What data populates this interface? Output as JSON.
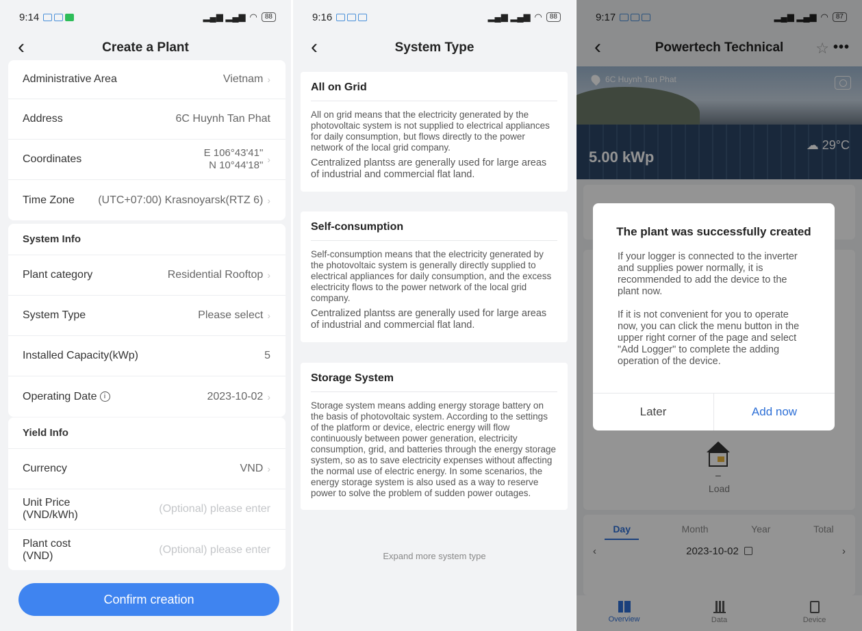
{
  "p1": {
    "status_time": "9:14",
    "battery": "88",
    "title": "Create a Plant",
    "location_rows": [
      {
        "label": "Administrative Area",
        "value": "Vietnam"
      },
      {
        "label": "Address",
        "value": "6C Huynh Tan Phat"
      },
      {
        "label": "Coordinates",
        "value_line1": "E 106°43'41\"",
        "value_line2": "N 10°44'18\""
      },
      {
        "label": "Time Zone",
        "value": "(UTC+07:00) Krasnoyarsk(RTZ 6)"
      }
    ],
    "system_info": {
      "heading": "System Info",
      "rows": [
        {
          "label": "Plant category",
          "value": "Residential Rooftop"
        },
        {
          "label": "System Type",
          "value": "Please select"
        },
        {
          "label": "Installed Capacity(kWp)",
          "value": "5"
        },
        {
          "label": "Operating Date",
          "value": "2023-10-02"
        }
      ]
    },
    "yield_info": {
      "heading": "Yield Info",
      "rows": [
        {
          "label": "Currency",
          "value": "VND"
        },
        {
          "label_line1": "Unit Price",
          "label_line2": "(VND/kWh)",
          "placeholder": "(Optional) please enter"
        },
        {
          "label_line1": "Plant cost",
          "label_line2": "(VND)",
          "placeholder": "(Optional) please enter"
        }
      ]
    },
    "confirm_label": "Confirm creation"
  },
  "p2": {
    "status_time": "9:16",
    "battery": "88",
    "title": "System Type",
    "cards": [
      {
        "title": "All on Grid",
        "desc": "All on grid means that the electricity generated by the photovoltaic system is not supplied to electrical appliances for daily consumption, but flows directly to the power network of the local grid company.",
        "note": "Centralized plantss are generally used for large areas of industrial and commercial flat land."
      },
      {
        "title": "Self-consumption",
        "desc": "Self-consumption means that the electricity generated by the photovoltaic system is generally directly supplied to electrical appliances for daily consumption, and the excess electricity flows to the power network of the local grid company.",
        "note": "Centralized plantss are generally used for large areas of industrial and commercial flat land."
      },
      {
        "title": "Storage System",
        "desc": "Storage system means adding energy storage battery on the basis of photovoltaic system. According to the settings of the platform or device, electric energy will flow continuously between power generation, electricity consumption, grid, and batteries through the energy storage system, so as to save electricity expenses without affecting the normal use of electric energy. In some scenarios, the energy storage system is also used as a way to reserve power to solve the problem of sudden power outages."
      }
    ],
    "expand_label": "Expand more system type"
  },
  "p3": {
    "status_time": "9:17",
    "battery": "87",
    "title": "Powertech Technical",
    "location": "6C Huynh Tan Phat",
    "capacity": "5.00 kWp",
    "temperature": "29°C",
    "load_value": "–",
    "load_label": "Load",
    "tabs": [
      "Day",
      "Month",
      "Year",
      "Total"
    ],
    "date": "2023-10-02",
    "bottom_tabs": [
      "Overview",
      "Data",
      "Device"
    ],
    "dialog": {
      "title": "The plant was successfully created",
      "p1": "If your logger is connected to the inverter and supplies power normally, it is recommended to add the device to the plant now.",
      "p2": "If it is not convenient for you to operate now, you can click the menu button in the upper right corner of the page and select \"Add Logger\" to complete the adding operation of the device.",
      "later": "Later",
      "add_now": "Add now"
    }
  }
}
